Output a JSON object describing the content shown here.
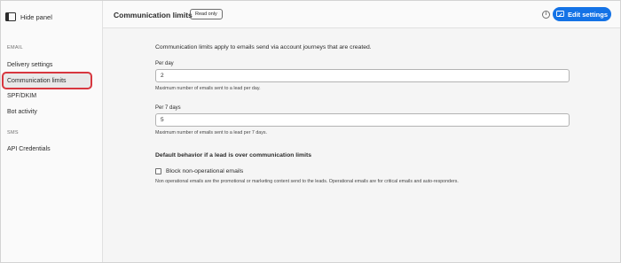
{
  "sidebar": {
    "hide_panel_label": "Hide panel",
    "sections": [
      {
        "label": "EMAIL",
        "items": [
          "Delivery settings",
          "Communication limits",
          "SPF/DKIM",
          "Bot activity"
        ]
      },
      {
        "label": "SMS",
        "items": [
          "API Credentials"
        ]
      }
    ],
    "active_item": "Communication limits"
  },
  "header": {
    "title": "Communication limits",
    "badge": "Read only",
    "info_icon": "info-icon",
    "edit_button_label": "Edit settings"
  },
  "main": {
    "intro": "Communication limits apply to emails send via account journeys that are created.",
    "fields": [
      {
        "label": "Per day",
        "value": "2",
        "help": "Maximum number of emails sent to a lead per day."
      },
      {
        "label": "Per 7 days",
        "value": "5",
        "help": "Maximum number of emails sent to a lead per 7 days."
      }
    ],
    "default_behavior_heading": "Default behavior if a lead is over communication limits",
    "checkbox_label": "Block non-operational emails",
    "checkbox_checked": false,
    "note": "Non operational emails are the promotional or marketing content send to the leads. Operational emails are for critical emails and auto-responders."
  },
  "colors": {
    "accent": "#1473e6",
    "active_outline": "#d7373f"
  }
}
